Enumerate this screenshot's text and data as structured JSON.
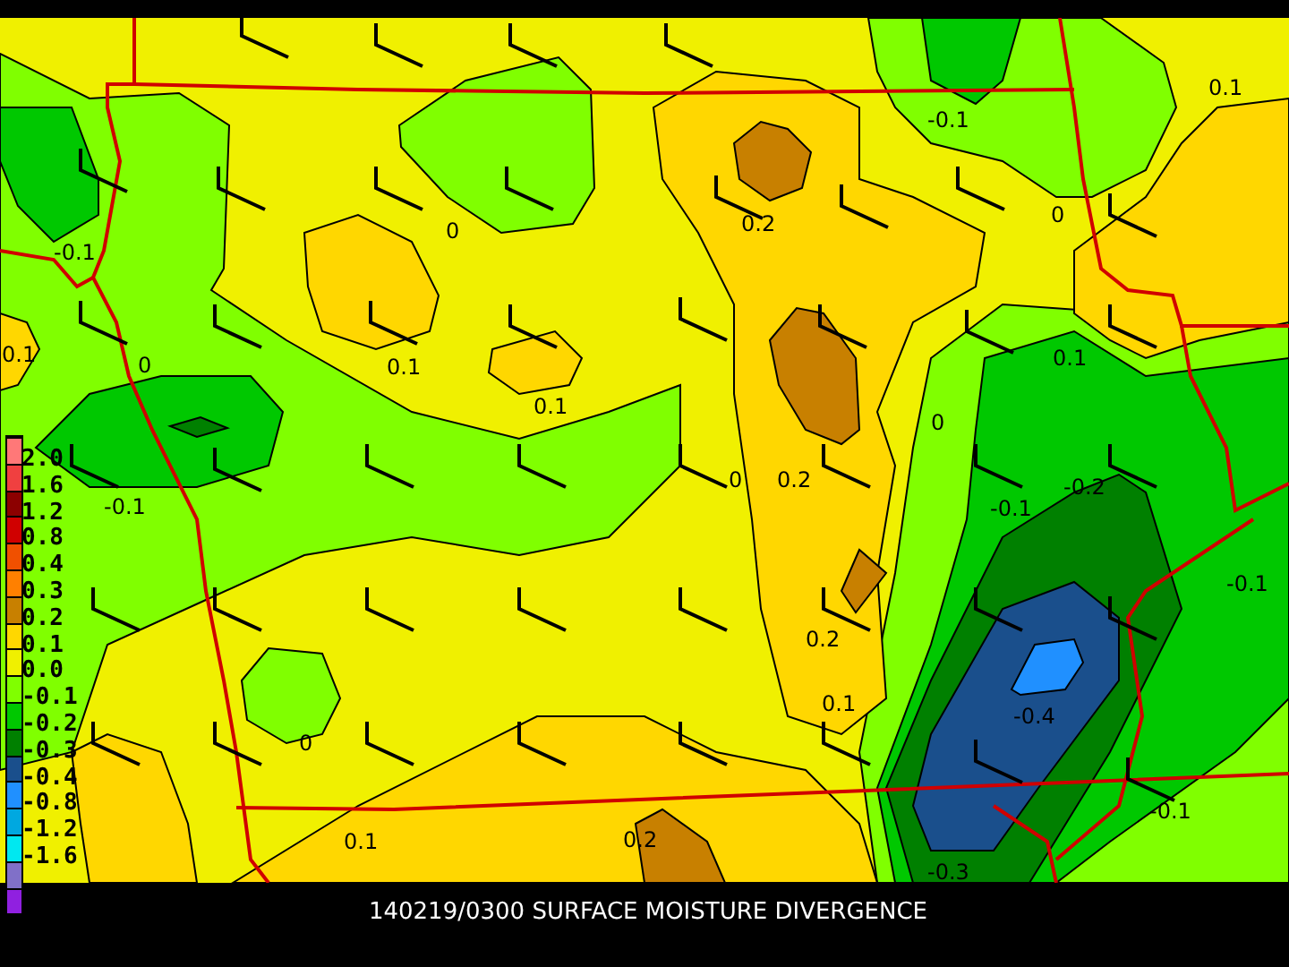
{
  "legend": {
    "swatches": [
      {
        "color": "#ff7878"
      },
      {
        "color": "#f04040"
      },
      {
        "color": "#8c0000"
      },
      {
        "color": "#d00000"
      },
      {
        "color": "#f05000"
      },
      {
        "color": "#ff8000"
      },
      {
        "color": "#c88000"
      },
      {
        "color": "#ffd700"
      },
      {
        "color": "#f0f000"
      },
      {
        "color": "#80ff00"
      },
      {
        "color": "#00c800"
      },
      {
        "color": "#008000"
      },
      {
        "color": "#1a4f8c"
      },
      {
        "color": "#2090ff"
      },
      {
        "color": "#00a8e0"
      },
      {
        "color": "#00e8f0"
      },
      {
        "color": "#8070c8"
      },
      {
        "color": "#9020e0"
      }
    ],
    "labels": [
      "2.0",
      "1.6",
      "1.2",
      "0.8",
      "0.4",
      "0.3",
      "0.2",
      "0.1",
      "0.0",
      "-0.1",
      "-0.2",
      "-0.3",
      "-0.4",
      "-0.8",
      "-1.2",
      "-1.6"
    ]
  },
  "contour_labels": [
    "-0.1",
    "0.1",
    "0",
    "-0.1",
    "0",
    "0.1",
    "0.1",
    "0.2",
    "-0.1",
    "0.1",
    "0",
    "0.1",
    "0",
    "0",
    "0.2",
    "-0.1",
    "-0.2",
    "-0.1",
    "0.2",
    "0.1",
    "-0.4",
    "0",
    "0.1",
    "0.2",
    "-0.1",
    "-0.3"
  ],
  "caption": "140219/0300 SURFACE MOISTURE DIVERGENCE"
}
